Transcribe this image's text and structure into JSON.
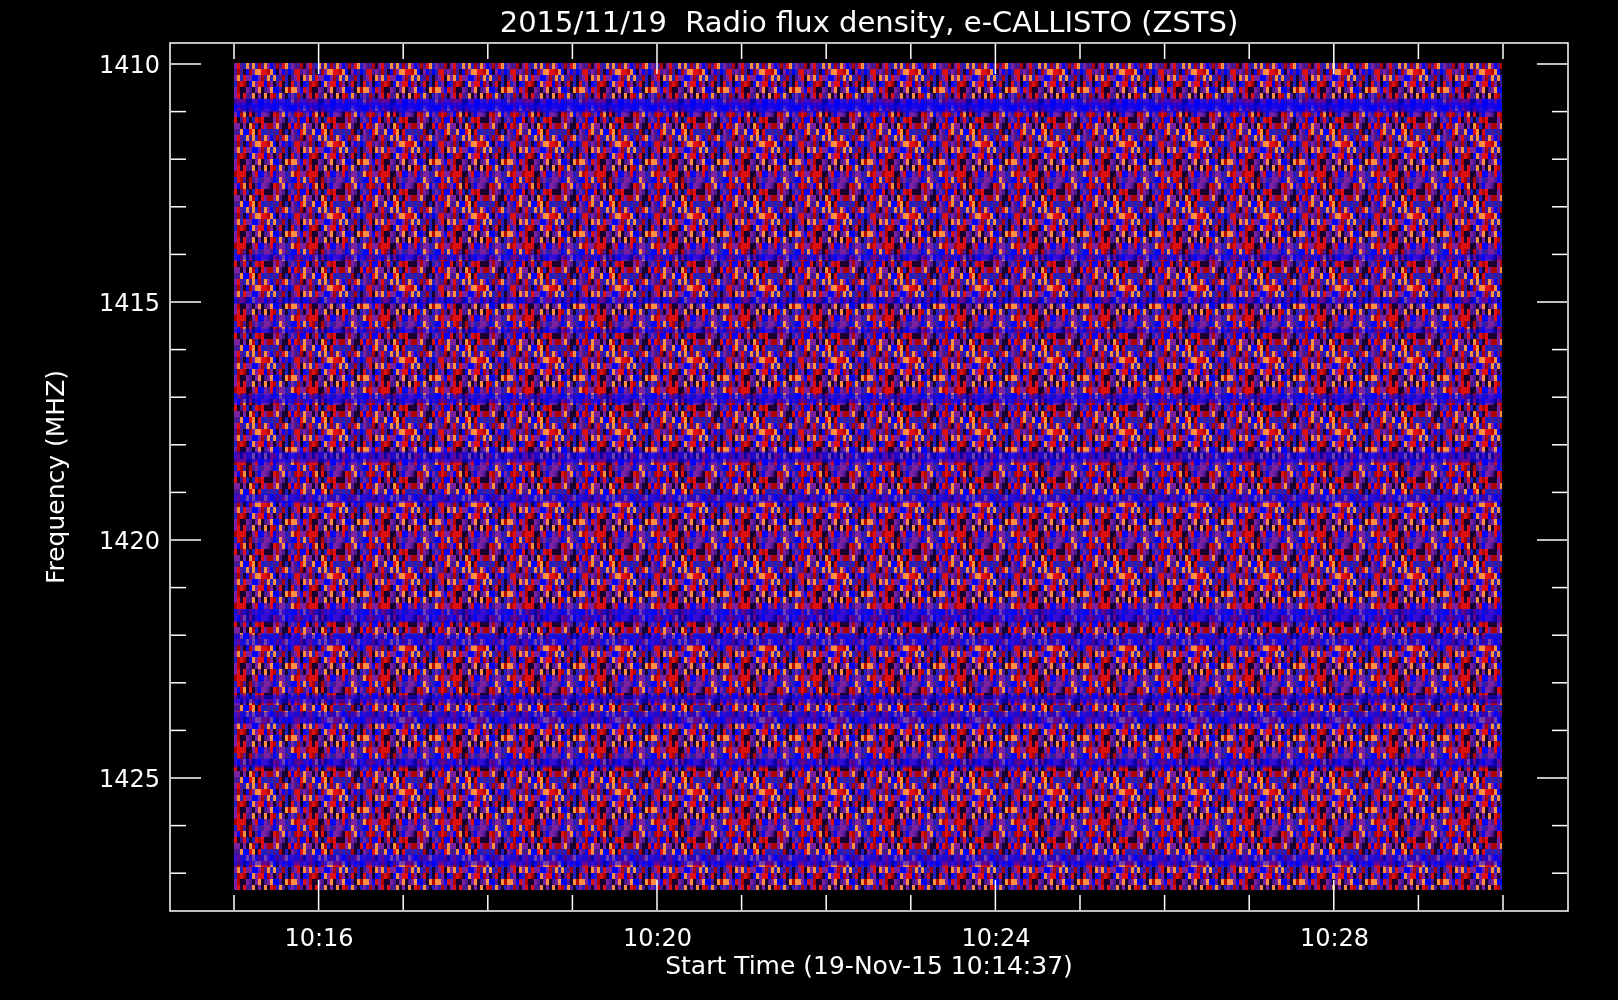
{
  "title": "2015/11/19  Radio flux density, e-CALLISTO (ZSTS)",
  "y_axis": {
    "label": "Frequency (MHZ)",
    "ticks": [
      "1410",
      "1415",
      "1420",
      "1425"
    ]
  },
  "x_axis": {
    "label": "Start Time (19-Nov-15 10:14:37)",
    "ticks": [
      "10:16",
      "10:20",
      "10:24",
      "10:28"
    ]
  }
}
